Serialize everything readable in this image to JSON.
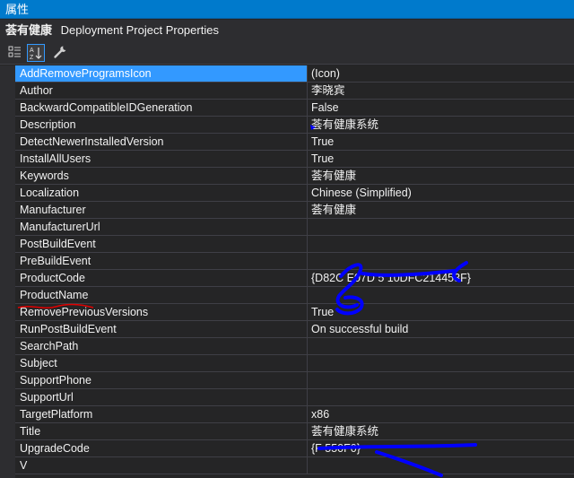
{
  "window": {
    "title": "属性"
  },
  "object_selector": {
    "name": "荟有健康",
    "type": "Deployment Project Properties"
  },
  "toolbar": {
    "buttons": [
      {
        "icon": "categorized-icon"
      },
      {
        "icon": "alphabetical-icon",
        "active": true
      },
      {
        "icon": "wrench-icon"
      }
    ]
  },
  "properties": [
    {
      "name": "AddRemoveProgramsIcon",
      "value": "(Icon)"
    },
    {
      "name": "Author",
      "value": "李晓宾"
    },
    {
      "name": "BackwardCompatibleIDGeneration",
      "value": "False"
    },
    {
      "name": "Description",
      "value": "荟有健康系统"
    },
    {
      "name": "DetectNewerInstalledVersion",
      "value": "True"
    },
    {
      "name": "InstallAllUsers",
      "value": "True"
    },
    {
      "name": "Keywords",
      "value": "荟有健康"
    },
    {
      "name": "Localization",
      "value": "Chinese (Simplified)"
    },
    {
      "name": "Manufacturer",
      "value": "荟有健康"
    },
    {
      "name": "ManufacturerUrl",
      "value": ""
    },
    {
      "name": "PostBuildEvent",
      "value": ""
    },
    {
      "name": "PreBuildEvent",
      "value": ""
    },
    {
      "name": "ProductCode",
      "value": "{D82C      E07D        5      10DFC214453F}"
    },
    {
      "name": "ProductName",
      "value": ""
    },
    {
      "name": "RemovePreviousVersions",
      "value": "True"
    },
    {
      "name": "RunPostBuildEvent",
      "value": "On successful build"
    },
    {
      "name": "SearchPath",
      "value": ""
    },
    {
      "name": "Subject",
      "value": ""
    },
    {
      "name": "SupportPhone",
      "value": ""
    },
    {
      "name": "SupportUrl",
      "value": ""
    },
    {
      "name": "TargetPlatform",
      "value": "x86"
    },
    {
      "name": "Title",
      "value": "荟有健康系统"
    },
    {
      "name": "UpgradeCode",
      "value": "{F                        550F0}"
    },
    {
      "name": "V",
      "value": ""
    }
  ],
  "colors": {
    "title_bar": "#007acc",
    "background": "#252526",
    "selection": "#3399ff",
    "scribble_blue": "#0000ff",
    "scribble_red": "#e00000"
  }
}
